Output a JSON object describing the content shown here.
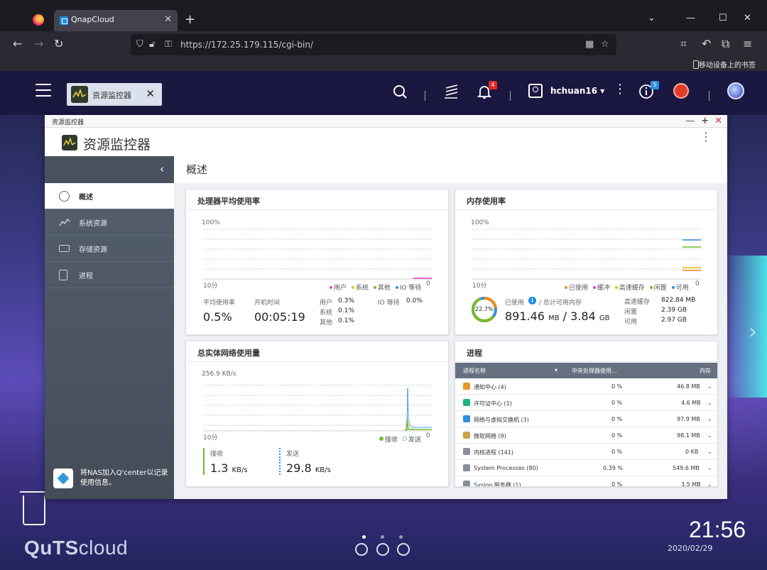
{
  "browser": {
    "tab_title": "QnapCloud",
    "url": "https://172.25.179.115/cgi-bin/",
    "bookmark_mobile": "移动设备上的书签"
  },
  "desktop": {
    "open_app": "资源监控器",
    "user": "hchuan16",
    "notification_badge": "4",
    "info_badge": "5",
    "brand": {
      "qu": "QuTS",
      "cloud": "cloud"
    },
    "clock": "21:56",
    "date": "2020/02/29"
  },
  "window": {
    "titlebar": "资源监控器",
    "header_title": "资源监控器",
    "sidebar": {
      "items": [
        {
          "label": "概述",
          "icon": "gauge-icon"
        },
        {
          "label": "系统资源",
          "icon": "line-chart-icon"
        },
        {
          "label": "存储资源",
          "icon": "disk-icon"
        },
        {
          "label": "进程",
          "icon": "list-icon"
        }
      ],
      "footer": "将NAS加入Q'center以记录使用信息。"
    },
    "main_title": "概述",
    "cpu": {
      "title": "处理器平均使用率",
      "y_top": "100%",
      "x_label": "10分",
      "zero": "0",
      "legend": [
        "用户",
        "系统",
        "其他",
        "IO 等待"
      ],
      "legend_colors": [
        "#e040c8",
        "#f2c400",
        "#77b82a",
        "#2f8ee0"
      ],
      "avg_label": "平均使用率",
      "avg_value": "0.5%",
      "uptime_label": "开机时间",
      "uptime_value": "00:05:19",
      "user_label": "用户",
      "user_value": "0.3%",
      "sys_label": "系统",
      "sys_value": "0.1%",
      "other_label": "其他",
      "other_value": "0.1%",
      "io_label": "IO 等待",
      "io_value": "0.0%"
    },
    "memory": {
      "title": "内存使用率",
      "y_top": "100%",
      "x_label": "10分",
      "zero": "0",
      "legend": [
        "已使用",
        "缓冲",
        "高速缓存",
        "闲置",
        "可用"
      ],
      "legend_colors": [
        "#f08a1c",
        "#e040c8",
        "#e6c200",
        "#77b82a",
        "#2f8ee0"
      ],
      "ring_pct": "22.7%",
      "used_label": "已使用",
      "total_label": "/ 总计可用内存",
      "used_value": "891.46",
      "used_unit": "MB",
      "sep": "/",
      "total_value": "3.84",
      "total_unit": "GB",
      "cache_label": "高速缓存",
      "cache_value": "822.84 MB",
      "free_label": "闲置",
      "free_value": "2.39 GB",
      "avail_label": "可用",
      "avail_value": "2.97 GB"
    },
    "network": {
      "title": "总实体网络使用量",
      "y_top": "256.9 KB/s",
      "x_label": "10分",
      "zero": "0",
      "legend": [
        "接收",
        "发送"
      ],
      "rx_label": "接收",
      "rx_value": "1.3",
      "rx_unit": "KB/s",
      "tx_label": "发送",
      "tx_value": "29.8",
      "tx_unit": "KB/s"
    },
    "processes": {
      "title": "进程",
      "columns": [
        "进程名称",
        "中央处理器使用...",
        "内存"
      ],
      "rows": [
        {
          "name": "通知中心 (4)",
          "cpu": "0 %",
          "mem": "46.8 MB",
          "color": "#e8962e"
        },
        {
          "name": "许可证中心 (1)",
          "cpu": "0 %",
          "mem": "4.6 MB",
          "color": "#1fb57a"
        },
        {
          "name": "网络与虚拟交换机 (3)",
          "cpu": "0 %",
          "mem": "97.9 MB",
          "color": "#2f8ee0"
        },
        {
          "name": "微软网络 (9)",
          "cpu": "0 %",
          "mem": "98.1 MB",
          "color": "#c8a24a"
        },
        {
          "name": "内核进程 (141)",
          "cpu": "0 %",
          "mem": "0 KB",
          "color": "#8a8f99"
        },
        {
          "name": "System Processes (80)",
          "cpu": "0.39 %",
          "mem": "549.6 MB",
          "color": "#8a8f99"
        },
        {
          "name": "Syslog 服务器 (1)",
          "cpu": "0 %",
          "mem": "3.5 MB",
          "color": "#8a8f99"
        }
      ]
    }
  }
}
